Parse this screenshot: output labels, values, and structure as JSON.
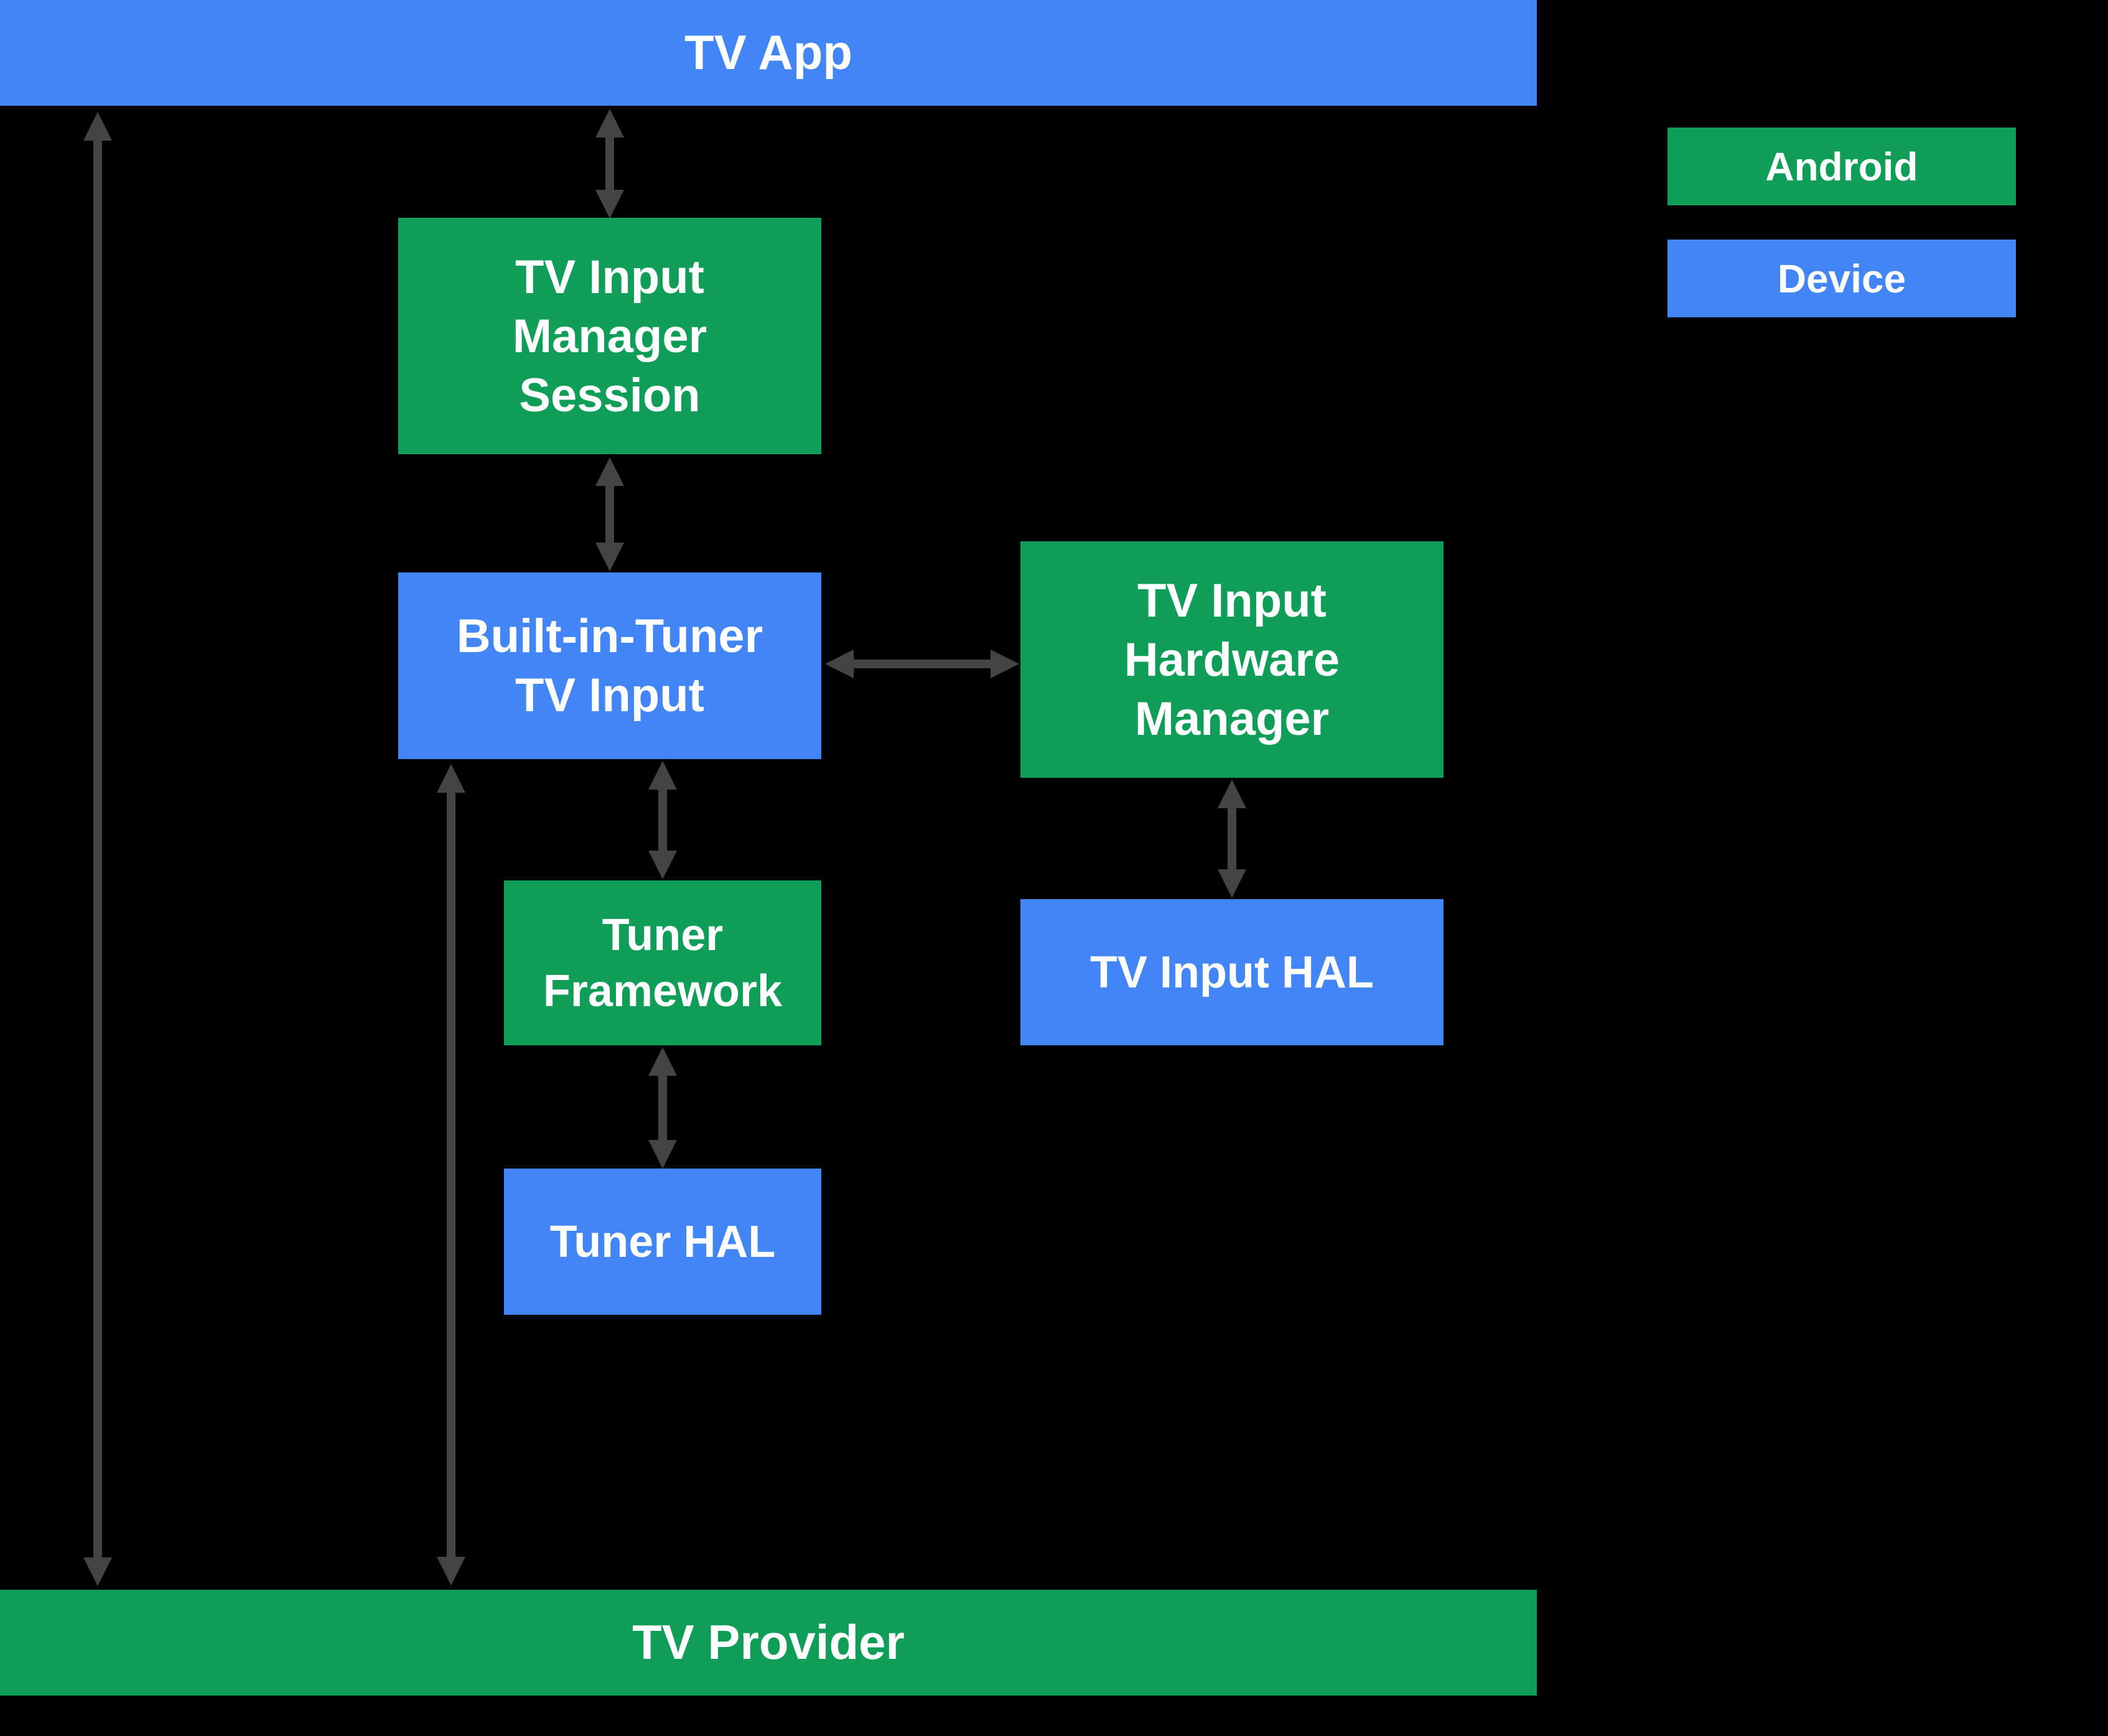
{
  "colors": {
    "blue": "#4285f4",
    "green": "#0f9d58",
    "arrow": "#444444"
  },
  "nodes": {
    "tv_app": "TV App",
    "tv_input_manager_session": "TV Input\nManager\nSession",
    "built_in_tuner_tv_input": "Built-in-Tuner\nTV Input",
    "tv_input_hardware_manager": "TV Input\nHardware\nManager",
    "tuner_framework": "Tuner\nFramework",
    "tv_input_hal": "TV Input HAL",
    "tuner_hal": "Tuner HAL",
    "tv_provider": "TV Provider"
  },
  "legend": {
    "android": "Android",
    "device": "Device"
  }
}
